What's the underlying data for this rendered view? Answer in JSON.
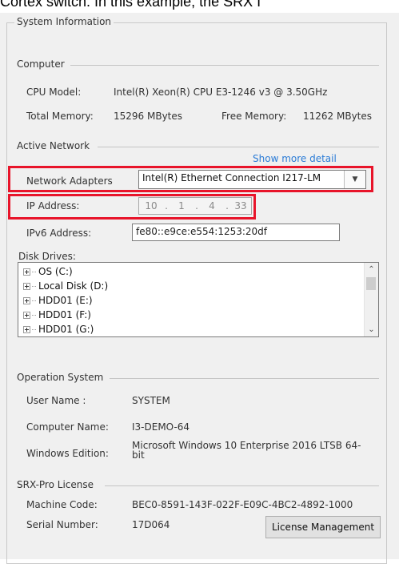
{
  "caption": "Cortex switch. In this example, the SRX I",
  "system_info": {
    "title": "System Information",
    "computer": {
      "section": "Computer",
      "cpu_label": "CPU Model:",
      "cpu_value": "Intel(R) Xeon(R) CPU E3-1246 v3 @ 3.50GHz",
      "total_mem_label": "Total Memory:",
      "total_mem_value": "15296 MBytes",
      "free_mem_label": "Free Memory:",
      "free_mem_value": "11262 MBytes"
    },
    "network": {
      "section": "Active Network",
      "show_more": "Show more detail",
      "adapters_label": "Network Adapters",
      "adapters_value": "Intel(R) Ethernet Connection I217-LM",
      "ip_label": "IP Address:",
      "ip_octets": [
        "10",
        "1",
        "4",
        "33"
      ],
      "ipv6_label": "IPv6 Address:",
      "ipv6_value": "fe80::e9ce:e554:1253:20df"
    },
    "disks": {
      "label": "Disk Drives:",
      "items": [
        "OS (C:)",
        "Local Disk (D:)",
        "HDD01 (E:)",
        "HDD01 (F:)",
        "HDD01 (G:)"
      ]
    },
    "os": {
      "section": "Operation System",
      "user_label": "User Name :",
      "user_value": "SYSTEM",
      "computer_label": "Computer Name:",
      "computer_value": "I3-DEMO-64",
      "edition_label": "Windows Edition:",
      "edition_value_line1": "Microsoft Windows 10 Enterprise 2016 LTSB 64-",
      "edition_value_line2": "bit"
    },
    "license": {
      "section": "SRX-Pro License",
      "machine_label": "Machine Code:",
      "machine_value": "BEC0-8591-143F-022F-E09C-4BC2-4892-1000",
      "serial_label": "Serial Number:",
      "serial_value": "17D064",
      "button": "License Management"
    }
  },
  "colors": {
    "highlight": "#e8142a",
    "link": "#2a7bd6",
    "panel_bg": "#f0f0f0"
  }
}
